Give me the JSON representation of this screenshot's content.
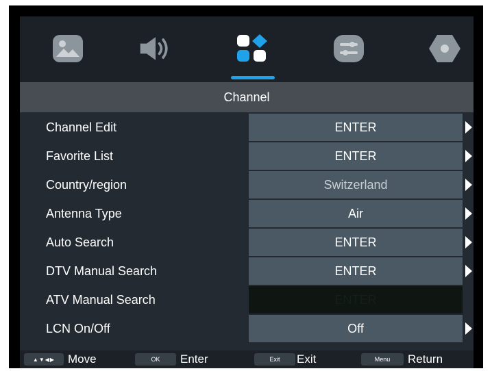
{
  "menu": {
    "title": "Channel",
    "tabs": [
      {
        "icon": "picture-icon"
      },
      {
        "icon": "sound-icon"
      },
      {
        "icon": "channel-icon",
        "active": true
      },
      {
        "icon": "settings-sliders-icon"
      },
      {
        "icon": "lock-icon"
      }
    ],
    "accent_color": "#1fa2ea"
  },
  "items": [
    {
      "label": "Channel Edit",
      "value": "ENTER"
    },
    {
      "label": "Favorite List",
      "value": "ENTER"
    },
    {
      "label": "Country/region",
      "value": "Switzerland"
    },
    {
      "label": "Antenna Type",
      "value": "Air"
    },
    {
      "label": "Auto Search",
      "value": "ENTER"
    },
    {
      "label": "DTV Manual Search",
      "value": "ENTER"
    },
    {
      "label": "ATV Manual Search",
      "value": "ENTER",
      "disabled": true
    },
    {
      "label": "LCN On/Off",
      "value": "Off"
    }
  ],
  "footer": {
    "move_key": "▲▼◀▶",
    "move_label": "Move",
    "ok_key": "OK",
    "enter_label": "Enter",
    "exit_key": "Exit",
    "exit_label": "Exit",
    "menu_key": "Menu",
    "return_label": "Return"
  }
}
